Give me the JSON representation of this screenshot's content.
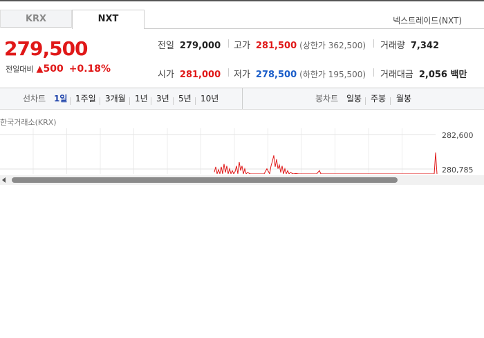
{
  "tabs": [
    {
      "label": "KRX",
      "active": false
    },
    {
      "label": "NXT",
      "active": true
    }
  ],
  "market_label": "넥스트레이드(NXT)",
  "quote": {
    "price": "279,500",
    "change_label": "전일대비",
    "change_direction": "up",
    "change_symbol": "▲",
    "change_amount": "500",
    "change_percent": "+0.18%"
  },
  "stats": {
    "prev_close": {
      "label": "전일",
      "value": "279,000"
    },
    "high": {
      "label": "고가",
      "value": "281,500",
      "sub": "(상한가 362,500)"
    },
    "volume": {
      "label": "거래량",
      "value": "7,342"
    },
    "open": {
      "label": "시가",
      "value": "281,000"
    },
    "low": {
      "label": "저가",
      "value": "278,500",
      "sub": "(하한가 195,500)"
    },
    "trade_value": {
      "label": "거래대금",
      "value": "2,056 백만"
    }
  },
  "line_chart_tabs": {
    "label": "선차트",
    "items": [
      "1일",
      "1주일",
      "3개월",
      "1년",
      "3년",
      "5년",
      "10년"
    ],
    "active": "1일"
  },
  "candle_chart_tabs": {
    "label": "봉차트",
    "items": [
      "일봉",
      "주봉",
      "월봉"
    ]
  },
  "chart": {
    "source": "한국거래소(KRX)",
    "y_ticks": [
      "282,600",
      "280,785"
    ]
  },
  "colors": {
    "up": "#e01818",
    "down": "#1a5dc9",
    "active_period": "#1a3fa8"
  },
  "chart_data": {
    "type": "line",
    "title": "",
    "xlabel": "",
    "ylabel": "",
    "y_ticks": [
      282600,
      280785
    ],
    "ylim": [
      279800,
      282800
    ],
    "grid": true,
    "series": [
      {
        "values": [
          [
            310,
            280620
          ],
          [
            312,
            280900
          ],
          [
            314,
            280450
          ],
          [
            316,
            280750
          ],
          [
            318,
            280500
          ],
          [
            320,
            280900
          ],
          [
            322,
            280350
          ],
          [
            324,
            281050
          ],
          [
            326,
            280600
          ],
          [
            328,
            280950
          ],
          [
            330,
            280500
          ],
          [
            332,
            280800
          ],
          [
            334,
            280300
          ],
          [
            336,
            280700
          ],
          [
            338,
            280200
          ],
          [
            340,
            280650
          ],
          [
            342,
            280950
          ],
          [
            344,
            280400
          ],
          [
            346,
            281150
          ],
          [
            348,
            280700
          ],
          [
            350,
            280950
          ],
          [
            352,
            280500
          ],
          [
            354,
            280800
          ],
          [
            356,
            280350
          ],
          [
            358,
            280600
          ],
          [
            362,
            280300
          ],
          [
            366,
            280500
          ],
          [
            370,
            280250
          ],
          [
            374,
            280400
          ],
          [
            378,
            280200
          ],
          [
            382,
            280450
          ],
          [
            386,
            280800
          ],
          [
            390,
            280400
          ],
          [
            392,
            280950
          ],
          [
            394,
            281200
          ],
          [
            396,
            281500
          ],
          [
            398,
            280900
          ],
          [
            400,
            281300
          ],
          [
            402,
            280800
          ],
          [
            404,
            281000
          ],
          [
            406,
            280600
          ],
          [
            408,
            280950
          ],
          [
            410,
            280500
          ],
          [
            412,
            280800
          ],
          [
            414,
            280400
          ],
          [
            416,
            280700
          ],
          [
            418,
            280350
          ],
          [
            420,
            280600
          ],
          [
            424,
            280400
          ],
          [
            428,
            280550
          ],
          [
            432,
            280300
          ],
          [
            436,
            280450
          ],
          [
            440,
            280250
          ],
          [
            446,
            280400
          ],
          [
            452,
            280300
          ],
          [
            458,
            280350
          ],
          [
            462,
            280700
          ],
          [
            464,
            280300
          ],
          [
            470,
            280350
          ],
          [
            480,
            280300
          ],
          [
            490,
            280320
          ],
          [
            500,
            280280
          ],
          [
            510,
            280300
          ],
          [
            520,
            280280
          ],
          [
            530,
            280300
          ],
          [
            540,
            280280
          ],
          [
            550,
            280300
          ],
          [
            560,
            280280
          ],
          [
            570,
            280300
          ],
          [
            580,
            280280
          ],
          [
            590,
            280300
          ],
          [
            600,
            280290
          ],
          [
            610,
            280300
          ],
          [
            620,
            280290
          ],
          [
            628,
            280300
          ],
          [
            630,
            281650
          ],
          [
            632,
            280300
          ]
        ]
      }
    ]
  }
}
